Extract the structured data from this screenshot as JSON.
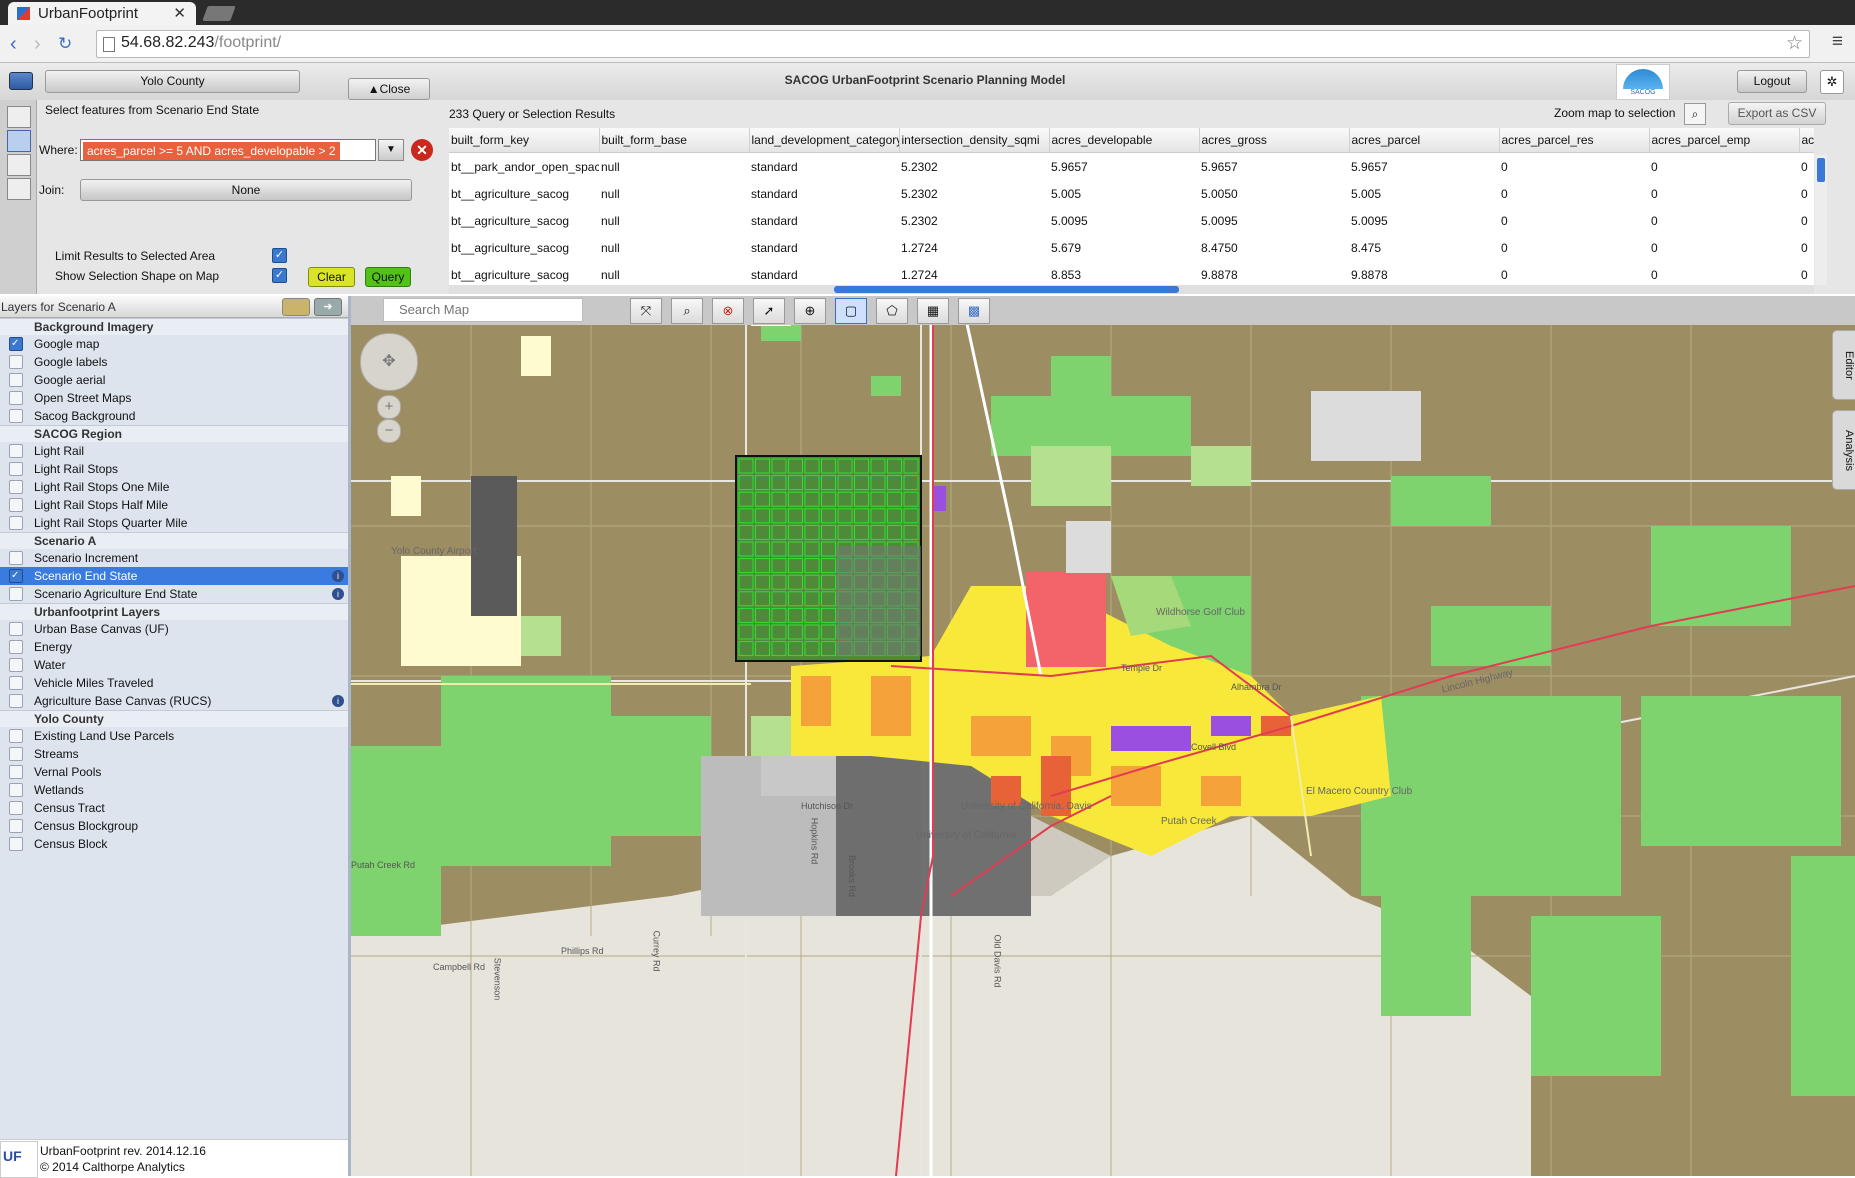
{
  "browser": {
    "tab_title": "UrbanFootprint",
    "url_host": "54.68.82.243",
    "url_path": "/footprint/"
  },
  "header": {
    "region_button": "Yolo County",
    "close_button": "Close",
    "title": "SACOG UrbanFootprint Scenario Planning Model",
    "logo_text": "SACOG",
    "logout_button": "Logout"
  },
  "query": {
    "heading": "Select features from Scenario End State",
    "where_label": "Where:",
    "where_value": "acres_parcel >= 5 AND acres_developable > 2",
    "join_label": "Join:",
    "join_value": "None",
    "limit_label": "Limit Results to Selected Area",
    "limit_checked": true,
    "show_shape_label": "Show Selection Shape on Map",
    "show_shape_checked": true,
    "clear_button": "Clear",
    "query_button": "Query"
  },
  "results": {
    "count_text": "233 Query or Selection Results",
    "zoom_text": "Zoom map to selection",
    "export_button": "Export as CSV",
    "columns": [
      "built_form_key",
      "built_form_base",
      "land_development_category",
      "intersection_density_sqmi",
      "acres_developable",
      "acres_gross",
      "acres_parcel",
      "acres_parcel_res",
      "acres_parcel_emp",
      "ac"
    ],
    "rows": [
      [
        "bt__park_andor_open_space",
        "null",
        "standard",
        "5.2302",
        "5.9657",
        "5.9657",
        "5.9657",
        "0",
        "0",
        "0"
      ],
      [
        "bt__agriculture_sacog",
        "null",
        "standard",
        "5.2302",
        "5.005",
        "5.0050",
        "5.005",
        "0",
        "0",
        "0"
      ],
      [
        "bt__agriculture_sacog",
        "null",
        "standard",
        "5.2302",
        "5.0095",
        "5.0095",
        "5.0095",
        "0",
        "0",
        "0"
      ],
      [
        "bt__agriculture_sacog",
        "null",
        "standard",
        "1.2724",
        "5.679",
        "8.4750",
        "8.475",
        "0",
        "0",
        "0"
      ],
      [
        "bt__agriculture_sacog",
        "null",
        "standard",
        "1.2724",
        "8.853",
        "9.8878",
        "9.8878",
        "0",
        "0",
        "0"
      ]
    ]
  },
  "layers": {
    "title": "Layers for Scenario A",
    "groups": [
      {
        "name": "Background Imagery",
        "items": [
          {
            "label": "Google map",
            "checked": true
          },
          {
            "label": "Google labels",
            "checked": false
          },
          {
            "label": "Google aerial",
            "checked": false
          },
          {
            "label": "Open Street Maps",
            "checked": false
          },
          {
            "label": "Sacog Background",
            "checked": false
          }
        ]
      },
      {
        "name": "SACOG Region",
        "items": [
          {
            "label": "Light Rail",
            "checked": false
          },
          {
            "label": "Light Rail Stops",
            "checked": false
          },
          {
            "label": "Light Rail Stops One Mile",
            "checked": false
          },
          {
            "label": "Light Rail Stops Half Mile",
            "checked": false
          },
          {
            "label": "Light Rail Stops Quarter Mile",
            "checked": false
          }
        ]
      },
      {
        "name": "Scenario A",
        "items": [
          {
            "label": "Scenario Increment",
            "checked": false
          },
          {
            "label": "Scenario End State",
            "checked": true,
            "selected": true,
            "info": true
          },
          {
            "label": "Scenario Agriculture End State",
            "checked": false,
            "info": true
          }
        ]
      },
      {
        "name": "Urbanfootprint Layers",
        "items": [
          {
            "label": "Urban Base Canvas (UF)",
            "checked": false
          },
          {
            "label": "Energy",
            "checked": false
          },
          {
            "label": "Water",
            "checked": false
          },
          {
            "label": "Vehicle Miles Traveled",
            "checked": false
          },
          {
            "label": "Agriculture Base Canvas (RUCS)",
            "checked": false,
            "info": true
          }
        ]
      },
      {
        "name": "Yolo County",
        "items": [
          {
            "label": "Existing Land Use Parcels",
            "checked": false
          },
          {
            "label": "Streams",
            "checked": false
          },
          {
            "label": "Vernal Pools",
            "checked": false
          },
          {
            "label": "Wetlands",
            "checked": false
          },
          {
            "label": "Census Tract",
            "checked": false
          },
          {
            "label": "Census Blockgroup",
            "checked": false
          },
          {
            "label": "Census Block",
            "checked": false
          }
        ]
      }
    ]
  },
  "footer": {
    "logo": "UF",
    "revision": "UrbanFootprint rev. 2014.12.16",
    "copyright": "© 2014 Calthorpe Analytics"
  },
  "map": {
    "search_placeholder": "Search Map",
    "editor_tab": "Editor",
    "analysis_tab": "Analysis",
    "labels": {
      "airport": "Yolo County Airport",
      "golf": "Wildhorse Golf Club",
      "davis1": "University of California, Davis",
      "davis2": "University of California",
      "putah": "Putah Creek",
      "putah_rd": "Putah Creek Rd",
      "el_macero": "El Macero Country Club",
      "lincoln": "Lincoln Highway",
      "hutchison": "Hutchison Dr",
      "phillips": "Phillips Rd",
      "campbell": "Campbell Rd",
      "old_davis": "Old Davis Rd",
      "stevenson": "Stevenson",
      "currey": "Currey Rd",
      "brooks": "Brooks Rd",
      "hopkins": "Hopkins Rd",
      "covell": "Covell Blvd",
      "alhambra": "Alhambra Dr",
      "temple": "Temple Dr"
    }
  }
}
